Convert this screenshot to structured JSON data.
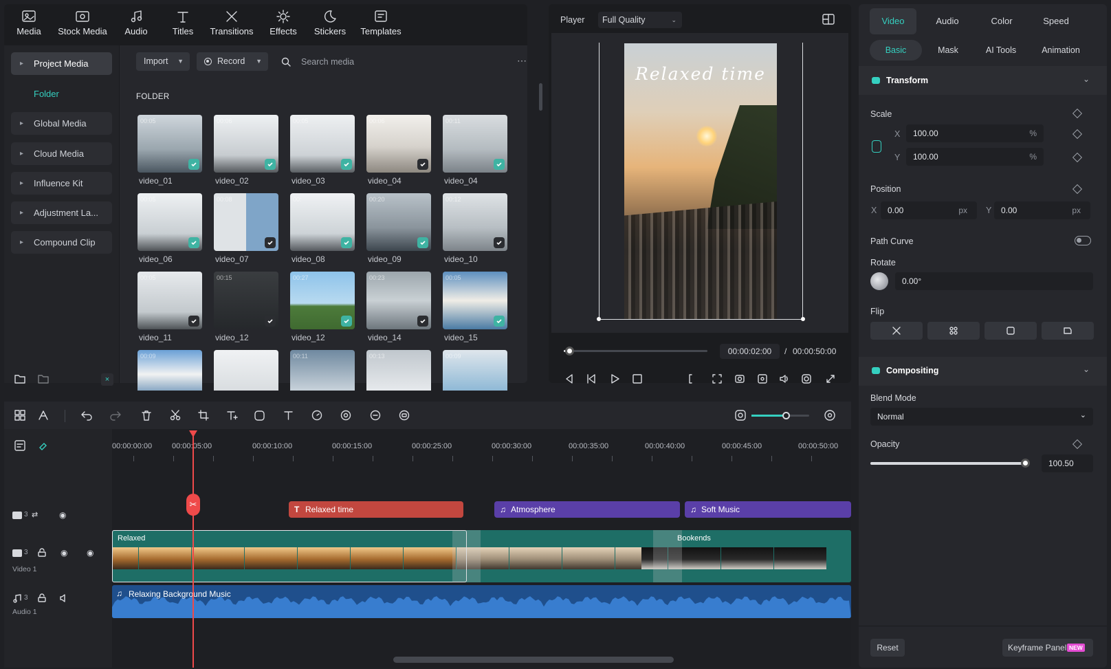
{
  "toolbar": {
    "items": [
      {
        "label": "Media",
        "icon": "media-icon"
      },
      {
        "label": "Stock Media",
        "icon": "stock-media-icon"
      },
      {
        "label": "Audio",
        "icon": "music-note-icon"
      },
      {
        "label": "Titles",
        "icon": "text-t-icon"
      },
      {
        "label": "Transitions",
        "icon": "transitions-icon"
      },
      {
        "label": "Effects",
        "icon": "sparkle-icon"
      },
      {
        "label": "Stickers",
        "icon": "sticker-icon"
      },
      {
        "label": "Templates",
        "icon": "templates-icon"
      }
    ]
  },
  "sidebar": {
    "items": [
      {
        "label": "Project Media"
      },
      {
        "label": "Folder"
      },
      {
        "label": "Global Media"
      },
      {
        "label": "Cloud Media"
      },
      {
        "label": "Influence Kit"
      },
      {
        "label": "Adjustment La..."
      },
      {
        "label": "Compound Clip"
      }
    ]
  },
  "media": {
    "import_label": "Import",
    "record_label": "Record",
    "search_placeholder": "Search media",
    "folder_heading": "FOLDER",
    "items": [
      {
        "name": "video_01",
        "duration": "00:05"
      },
      {
        "name": "video_02",
        "duration": "00:06"
      },
      {
        "name": "video_03",
        "duration": "00:05"
      },
      {
        "name": "video_04",
        "duration": "00:06"
      },
      {
        "name": "video_04",
        "duration": "00:11"
      },
      {
        "name": "video_06",
        "duration": "00:05"
      },
      {
        "name": "video_07",
        "duration": "00:08"
      },
      {
        "name": "video_08",
        "duration": "00:"
      },
      {
        "name": "video_09",
        "duration": "00:20"
      },
      {
        "name": "video_10",
        "duration": "00:12"
      },
      {
        "name": "video_11",
        "duration": "00:05"
      },
      {
        "name": "video_12",
        "duration": "00:15"
      },
      {
        "name": "video_12",
        "duration": "00:27"
      },
      {
        "name": "video_14",
        "duration": "00:23"
      },
      {
        "name": "video_15",
        "duration": "00:05"
      },
      {
        "name": "",
        "duration": "00:09"
      },
      {
        "name": "",
        "duration": ""
      },
      {
        "name": "",
        "duration": "00:11"
      },
      {
        "name": "",
        "duration": "00:13"
      },
      {
        "name": "",
        "duration": "00:09"
      }
    ]
  },
  "player": {
    "label": "Player",
    "quality": "Full Quality",
    "title_overlay": "Relaxed time",
    "current_time": "00:00:02:00",
    "separator": "/",
    "total_time": "00:00:50:00",
    "progress": 0.04
  },
  "inspector": {
    "tabs": [
      "Video",
      "Audio",
      "Color",
      "Speed"
    ],
    "subtabs": [
      "Basic",
      "Mask",
      "AI Tools",
      "Animation"
    ],
    "transform_label": "Transform",
    "scale_label": "Scale",
    "scale_x": "100.00",
    "scale_y": "100.00",
    "x_letter": "X",
    "y_letter": "Y",
    "percent": "%",
    "position_label": "Position",
    "pos_x": "0.00",
    "pos_y": "0.00",
    "px_unit": "px",
    "path_curve_label": "Path Curve",
    "rotate_label": "Rotate",
    "rotate_value": "0.00°",
    "flip_label": "Flip",
    "compositing_label": "Compositing",
    "blend_mode_label": "Blend Mode",
    "blend_mode_value": "Normal",
    "opacity_label": "Opacity",
    "opacity_value": "100.50",
    "opacity_level": 0.98,
    "reset_label": "Reset",
    "keyframe_label": "Keyframe Panel",
    "new_badge": "NEW",
    "accent": "#35d0c0"
  },
  "timeline": {
    "ruler": [
      "00:00:00:00",
      "00:00:05:00",
      "00:00:10:00",
      "00:00:15:00",
      "00:00:25:00",
      "00:00:30:00",
      "00:00:35:00",
      "00:00:40:00",
      "00:00:45:00",
      "00:00:50:00"
    ],
    "title_clip": "Relaxed time",
    "atmosphere_clip": "Atmosphere",
    "soft_music_clip": "Soft Music",
    "video_clip_1": "Relaxed",
    "video_clip_2": "Bookends",
    "audio_clip": "Relaxing Background Music",
    "video_track_label": "Video 1",
    "audio_track_label": "Audio 1",
    "track_number": "3",
    "zoom_level": 0.6,
    "colors": {
      "title": "#c2473f",
      "music": "#5a3fa8",
      "video": "#1e6e66",
      "audio": "#1f4f8c",
      "playhead": "#ef4a4a"
    }
  }
}
